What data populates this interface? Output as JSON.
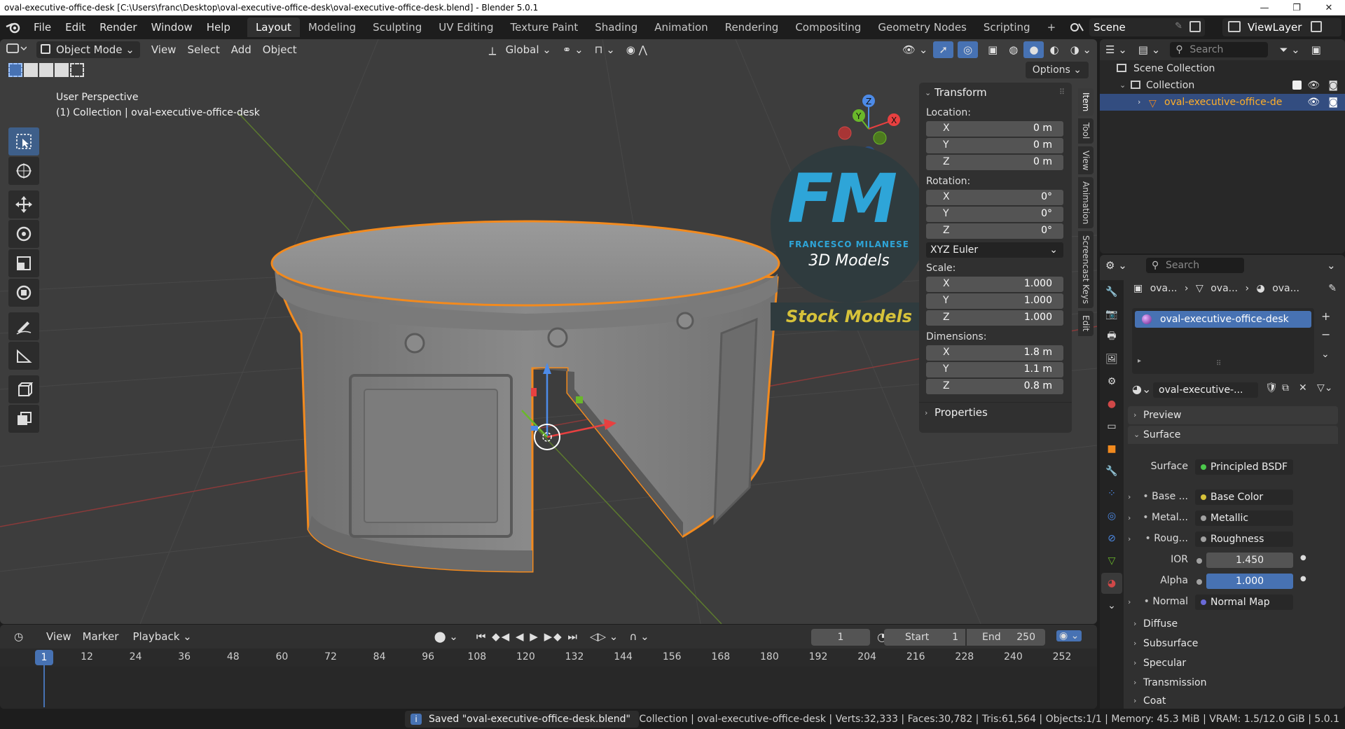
{
  "window": {
    "title": "oval-executive-office-desk [C:\\Users\\franc\\Desktop\\oval-executive-office-desk\\oval-executive-office-desk.blend] - Blender 5.0.1",
    "minimize": "—",
    "maximize": "❐",
    "close": "✕"
  },
  "menu": {
    "file": "File",
    "edit": "Edit",
    "render": "Render",
    "window": "Window",
    "help": "Help"
  },
  "workspaces": [
    "Layout",
    "Modeling",
    "Sculpting",
    "UV Editing",
    "Texture Paint",
    "Shading",
    "Animation",
    "Rendering",
    "Compositing",
    "Geometry Nodes",
    "Scripting",
    "+"
  ],
  "scene": {
    "name": "Scene",
    "viewlayer": "ViewLayer"
  },
  "viewport": {
    "mode": "Object Mode",
    "menu": {
      "view": "View",
      "select": "Select",
      "add": "Add",
      "object": "Object"
    },
    "orientation": "Global",
    "options": "Options",
    "info_line1": "User Perspective",
    "info_line2": "(1) Collection | oval-executive-office-desk",
    "gizmo": {
      "x": "X",
      "y": "Y",
      "z": "Z"
    },
    "watermark": {
      "letters": "FM",
      "name": "FRANCESCO MILANESE",
      "sub": "3D Models",
      "banner": "Stock Models"
    }
  },
  "npanel": {
    "title": "Transform",
    "location_label": "Location:",
    "location": [
      {
        "axis": "X",
        "value": "0 m"
      },
      {
        "axis": "Y",
        "value": "0 m"
      },
      {
        "axis": "Z",
        "value": "0 m"
      }
    ],
    "rotation_label": "Rotation:",
    "rotation": [
      {
        "axis": "X",
        "value": "0°"
      },
      {
        "axis": "Y",
        "value": "0°"
      },
      {
        "axis": "Z",
        "value": "0°"
      }
    ],
    "rotation_mode": "XYZ Euler",
    "scale_label": "Scale:",
    "scale": [
      {
        "axis": "X",
        "value": "1.000"
      },
      {
        "axis": "Y",
        "value": "1.000"
      },
      {
        "axis": "Z",
        "value": "1.000"
      }
    ],
    "dimensions_label": "Dimensions:",
    "dimensions": [
      {
        "axis": "X",
        "value": "1.8 m"
      },
      {
        "axis": "Y",
        "value": "1.1 m"
      },
      {
        "axis": "Z",
        "value": "0.8 m"
      }
    ],
    "properties": "Properties",
    "tabs": [
      "Item",
      "Tool",
      "View",
      "Animation",
      "Screencast Keys",
      "Edit"
    ]
  },
  "outliner": {
    "search_placeholder": "Search",
    "scene_collection": "Scene Collection",
    "collection": "Collection",
    "object": "oval-executive-office-de"
  },
  "properties": {
    "search_placeholder": "Search",
    "breadcrumb": [
      "ova...",
      "ova...",
      "ova..."
    ],
    "material_slot": "oval-executive-office-desk",
    "material_name": "oval-executive-...",
    "preview": "Preview",
    "surface_section": "Surface",
    "surface_label": "Surface",
    "surface_value": "Principled BSDF",
    "rows": [
      {
        "label": "Base ...",
        "value": "Base Color",
        "dot": "#d6c23a"
      },
      {
        "label": "Metal...",
        "value": "Metallic",
        "dot": "#a1a1a1"
      },
      {
        "label": "Roug...",
        "value": "Roughness",
        "dot": "#a1a1a1"
      }
    ],
    "ior_label": "IOR",
    "ior_value": "1.450",
    "alpha_label": "Alpha",
    "alpha_value": "1.000",
    "normal_label": "Normal",
    "normal_value": "Normal Map",
    "sections": [
      "Diffuse",
      "Subsurface",
      "Specular",
      "Transmission",
      "Coat"
    ]
  },
  "timeline": {
    "menu": {
      "view": "View",
      "marker": "Marker",
      "playback": "Playback"
    },
    "current_frame": "1",
    "start_label": "Start",
    "start": "1",
    "end_label": "End",
    "end": "250",
    "ticks": [
      "12",
      "24",
      "36",
      "48",
      "60",
      "72",
      "84",
      "96",
      "108",
      "120",
      "132",
      "144",
      "156",
      "168",
      "180",
      "192",
      "204",
      "216",
      "228",
      "240",
      "252"
    ]
  },
  "status": {
    "message": "Saved \"oval-executive-office-desk.blend\"",
    "stats": "Collection | oval-executive-office-desk | Verts:32,333 | Faces:30,782 | Tris:61,564 | Objects:1/1 | Memory: 45.3 MiB | VRAM: 1.5/12.0 GiB | 5.0.1"
  }
}
